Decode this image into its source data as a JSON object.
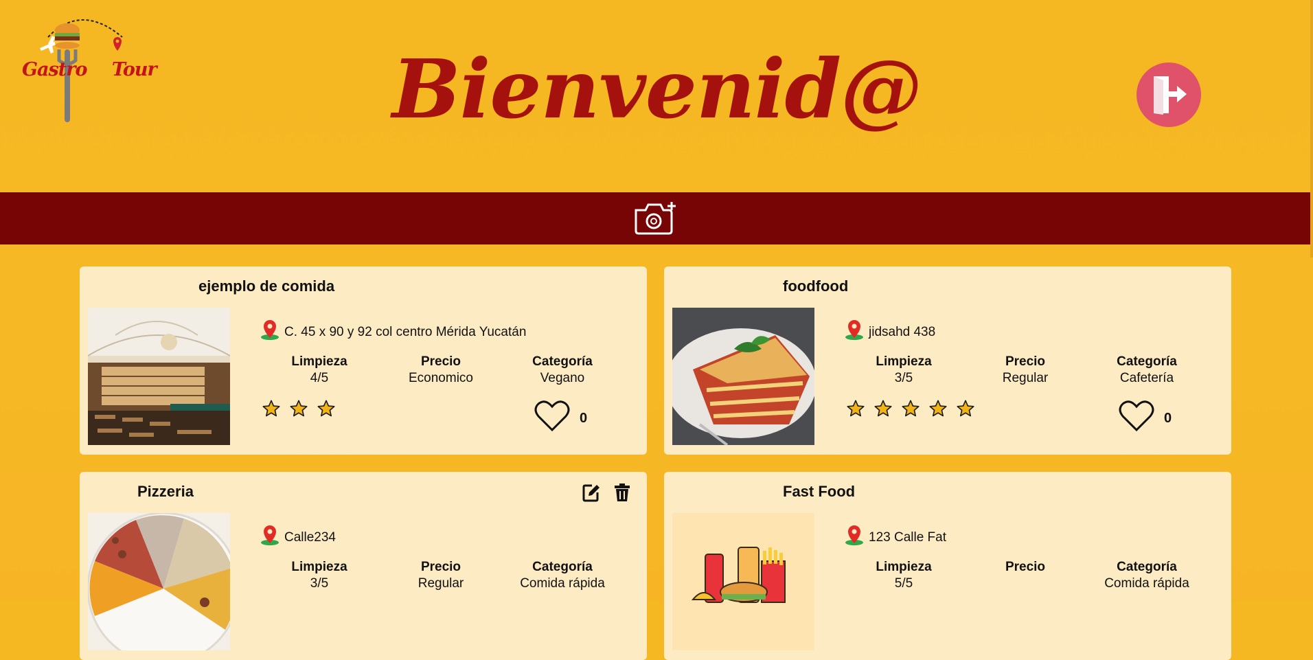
{
  "header": {
    "logo_text": "Gastro Tour",
    "welcome": "Bienvenid@",
    "logout_icon": "logout-door-icon"
  },
  "toolbar": {
    "add_photo_icon": "camera-add-icon"
  },
  "colors": {
    "background": "#f5b722",
    "bar": "#780506",
    "title": "#a5120d",
    "card": "#fdebc3",
    "logout": "#e0516a",
    "star": "#f2b316"
  },
  "labels": {
    "cleanliness": "Limpieza",
    "price": "Precio",
    "category": "Categoría"
  },
  "cards": [
    {
      "name": "ejemplo de comida",
      "address": "C. 45 x 90 y 92 col centro Mérida Yucatán",
      "cleanliness": "4/5",
      "price": "Economico",
      "category": "Vegano",
      "rating": 3,
      "likes": "0",
      "image": "restaurant-interior-photo"
    },
    {
      "name": "foodfood",
      "address": "jidsahd 438",
      "cleanliness": "3/5",
      "price": "Regular",
      "category": "Cafetería",
      "rating": 5,
      "likes": "0",
      "image": "lasagna-photo"
    },
    {
      "name": "Pizzeria",
      "address": "Calle234",
      "cleanliness": "3/5",
      "price": "Regular",
      "category": "Comida rápida",
      "image": "spice-plate-photo",
      "actions": [
        "edit-icon",
        "trash-icon"
      ]
    },
    {
      "name": "Fast Food",
      "address": "123 Calle Fat",
      "cleanliness": "5/5",
      "price": "",
      "category": "Comida rápida",
      "image": "fast-food-illustration"
    }
  ]
}
